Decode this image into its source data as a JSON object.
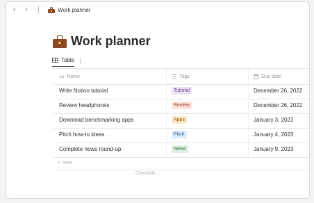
{
  "topbar": {
    "back_icon": "chevron-left-icon",
    "forward_icon": "chevron-right-icon",
    "breadcrumb": "Work planner"
  },
  "page": {
    "title": "Work planner",
    "icon": "briefcase-icon"
  },
  "views": {
    "tabs": [
      {
        "label": "Table",
        "icon": "table-icon",
        "active": true
      }
    ]
  },
  "table": {
    "columns": [
      {
        "label": "Name",
        "icon": "text-icon"
      },
      {
        "label": "Tags",
        "icon": "list-icon"
      },
      {
        "label": "Due date",
        "icon": "calendar-icon"
      }
    ],
    "rows": [
      {
        "name": "Write Notion tutorial",
        "tag": "Tutorial",
        "tag_bg": "#ebe1f5",
        "tag_fg": "#6b3f93",
        "date": "December 26, 2022"
      },
      {
        "name": "Review headphones",
        "tag": "Review",
        "tag_bg": "#fbe2dc",
        "tag_fg": "#9c3a2a",
        "date": "December 26, 2022"
      },
      {
        "name": "Download benchmarking apps",
        "tag": "Apps",
        "tag_bg": "#fbeccc",
        "tag_fg": "#8a5a12",
        "date": "January 3, 2023"
      },
      {
        "name": "Pitch how-to ideas",
        "tag": "Pitch",
        "tag_bg": "#dcecfa",
        "tag_fg": "#2d5f8a",
        "date": "January 4, 2023"
      },
      {
        "name": "Complete news round-up",
        "tag": "News",
        "tag_bg": "#dff0e2",
        "tag_fg": "#2f6b3c",
        "date": "January 9, 2023"
      }
    ],
    "new_label": "New",
    "calculate_label": "Calculate"
  }
}
